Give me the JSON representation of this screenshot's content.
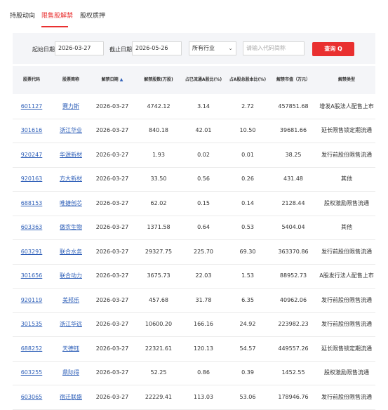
{
  "tabs": [
    {
      "label": "持股动向"
    },
    {
      "label": "限售股解禁"
    },
    {
      "label": "股权质押"
    }
  ],
  "filter": {
    "start_label": "起始日期：",
    "start_value": "2026-03-27",
    "end_label": "截止日期：",
    "end_value": "2026-05-26",
    "industry_value": "所有行业",
    "search_placeholder": "请输入代码简称",
    "search_button": "查询 Q"
  },
  "table": {
    "headers": {
      "code": "股票代码",
      "name": "股票简称",
      "date": "解禁日期",
      "shares": "解禁股数(万股)",
      "pct_float": "占已流通A股比(%)",
      "pct_total": "占A股总股本比(%)",
      "value": "解禁市值（万元）",
      "type": "解禁类型"
    },
    "sort_arrow": "▲",
    "rows": [
      {
        "code": "601127",
        "name": "赛力斯",
        "date": "2026-03-27",
        "shares": "4742.12",
        "pct_float": "3.14",
        "pct_total": "2.72",
        "value": "457851.68",
        "type": "增发A股法人配售上市"
      },
      {
        "code": "301616",
        "name": "浙江华业",
        "date": "2026-03-27",
        "shares": "840.18",
        "pct_float": "42.01",
        "pct_total": "10.50",
        "value": "39681.66",
        "type": "延长限售锁定期流通"
      },
      {
        "code": "920247",
        "name": "华源新材",
        "date": "2026-03-27",
        "shares": "1.93",
        "pct_float": "0.02",
        "pct_total": "0.01",
        "value": "38.25",
        "type": "发行前股份限售流通"
      },
      {
        "code": "920163",
        "name": "方大新材",
        "date": "2026-03-27",
        "shares": "33.50",
        "pct_float": "0.56",
        "pct_total": "0.26",
        "value": "431.48",
        "type": "其他"
      },
      {
        "code": "688153",
        "name": "唯捷创芯",
        "date": "2026-03-27",
        "shares": "62.02",
        "pct_float": "0.15",
        "pct_total": "0.14",
        "value": "2128.44",
        "type": "股权激励限售流通"
      },
      {
        "code": "603363",
        "name": "傲农生物",
        "date": "2026-03-27",
        "shares": "1371.58",
        "pct_float": "0.64",
        "pct_total": "0.53",
        "value": "5404.04",
        "type": "其他"
      },
      {
        "code": "603291",
        "name": "联合水务",
        "date": "2026-03-27",
        "shares": "29327.75",
        "pct_float": "225.70",
        "pct_total": "69.30",
        "value": "363370.86",
        "type": "发行前股份限售流通"
      },
      {
        "code": "301656",
        "name": "联合动力",
        "date": "2026-03-27",
        "shares": "3675.73",
        "pct_float": "22.03",
        "pct_total": "1.53",
        "value": "88952.73",
        "type": "A股发行法人配售上市"
      },
      {
        "code": "920119",
        "name": "美邦乐",
        "date": "2026-03-27",
        "shares": "457.68",
        "pct_float": "31.78",
        "pct_total": "6.35",
        "value": "40962.06",
        "type": "发行前股份限售流通"
      },
      {
        "code": "301535",
        "name": "浙江华远",
        "date": "2026-03-27",
        "shares": "10600.20",
        "pct_float": "166.16",
        "pct_total": "24.92",
        "value": "223982.23",
        "type": "发行前股份限售流通"
      },
      {
        "code": "688252",
        "name": "天德钰",
        "date": "2026-03-27",
        "shares": "22321.61",
        "pct_float": "120.13",
        "pct_total": "54.57",
        "value": "449557.26",
        "type": "延长限售锁定期流通"
      },
      {
        "code": "603255",
        "name": "鼎际得",
        "date": "2026-03-27",
        "shares": "52.25",
        "pct_float": "0.86",
        "pct_total": "0.39",
        "value": "1452.55",
        "type": "股权激励限售流通"
      },
      {
        "code": "603065",
        "name": "宿迁联盛",
        "date": "2026-03-27",
        "shares": "22229.41",
        "pct_float": "113.03",
        "pct_total": "53.06",
        "value": "178946.76",
        "type": "发行前股份限售流通"
      }
    ]
  }
}
